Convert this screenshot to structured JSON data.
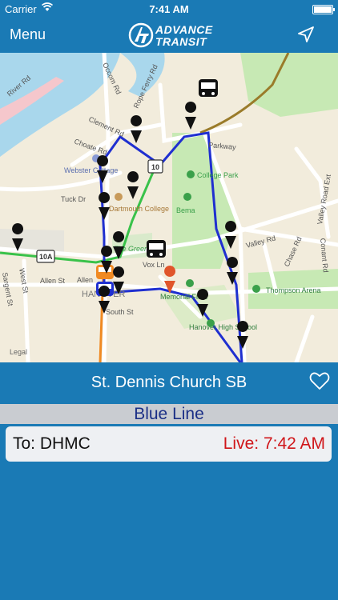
{
  "status_bar": {
    "carrier": "Carrier",
    "time": "7:41 AM"
  },
  "nav": {
    "menu_label": "Menu",
    "logo_line1": "ADVANCE",
    "logo_line2": "TRANSIT",
    "location_icon": "location-arrow-icon"
  },
  "map": {
    "labels": {
      "river_rd": "River Rd",
      "occom_rd": "Occom Rd",
      "rope_ferry": "Rope Ferry Rd",
      "clement_rd": "Clement Rd",
      "choate_rd": "Choate Rd",
      "webster_cottage": "Webster Cottage",
      "tuck_dr": "Tuck Dr",
      "dartmouth_college": "Dartmouth College",
      "the_green": "The Green",
      "college_park": "College Park",
      "bema": "Bema",
      "parkway": "Parkway",
      "valley_rd": "Valley Rd",
      "valley_road_ext": "Valley Road Ext",
      "chase_rd": "Chase Rd",
      "conant_rd": "Conant Rd",
      "thompson_arena": "Thompson Arena",
      "memorial_field": "Memorial Field",
      "vox_ln": "Vox Ln",
      "allen_st": "Allen St",
      "allen_st2": "Allen",
      "hanover": "HANOVER",
      "south_st": "South St",
      "west_st": "West St",
      "sargent_st": "Sargent St",
      "hanover_hs": "Hanover High School",
      "route_10a": "10A",
      "route_10": "10",
      "legal": "Legal"
    }
  },
  "stop": {
    "name": "St. Dennis Church SB"
  },
  "line": {
    "name": "Blue Line"
  },
  "arrival": {
    "destination": "To: DHMC",
    "live": "Live: 7:42 AM"
  },
  "colors": {
    "primary": "#1a7ab5",
    "route_blue": "#1f2fd0",
    "route_green": "#39c24a",
    "live_red": "#d0161a",
    "line_name": "#1b2f86"
  }
}
